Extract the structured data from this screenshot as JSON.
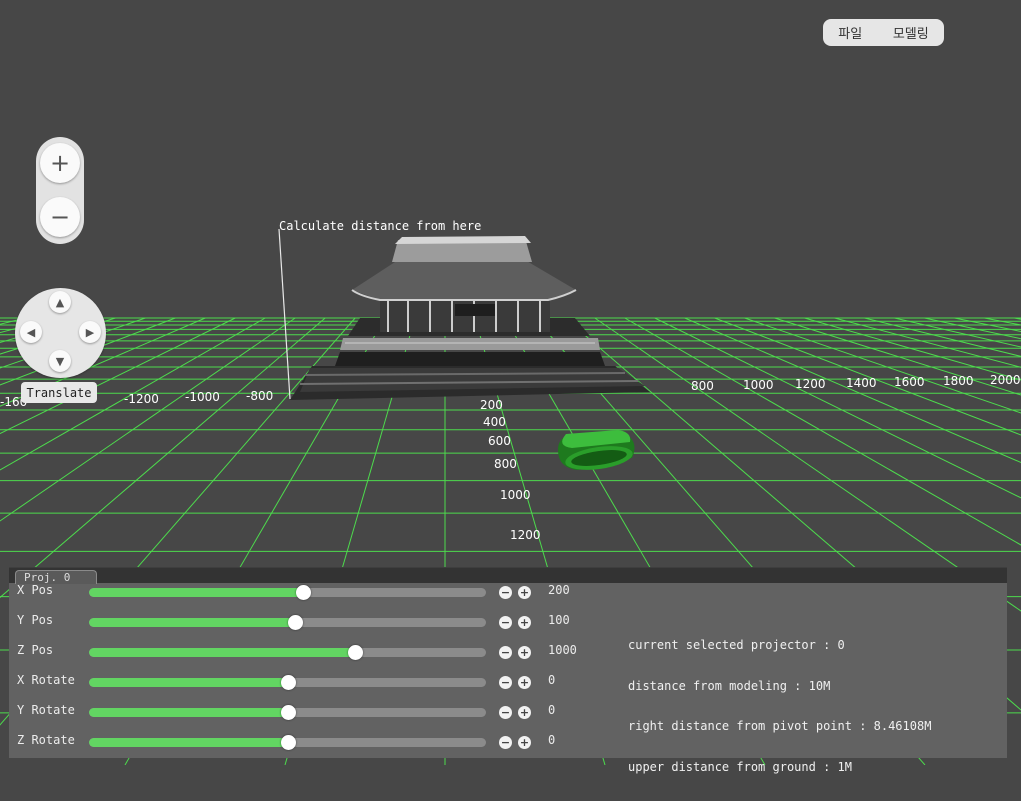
{
  "menu": {
    "file_label": "파일",
    "modeling_label": "모델링"
  },
  "zoom": {
    "in_symbol": "+",
    "out_symbol": "−"
  },
  "pad": {
    "up": "▲",
    "down": "▼",
    "left": "◀",
    "right": "▶",
    "mode_label": "Translate"
  },
  "scene": {
    "measure_label": "Calculate distance from here",
    "grid_color": "#4ddb4d",
    "x_ticks": [
      "-160",
      "-1200",
      "-1000",
      "-800",
      "800",
      "1000",
      "1200",
      "1400",
      "1600",
      "1800",
      "2000"
    ],
    "z_ticks": [
      "200",
      "400",
      "600",
      "800",
      "1000",
      "1200"
    ]
  },
  "panel": {
    "tab_label": "Proj. 0",
    "sliders": [
      {
        "label": "X Pos",
        "value": "200",
        "fraction": 0.54
      },
      {
        "label": "Y Pos",
        "value": "100",
        "fraction": 0.52
      },
      {
        "label": "Z Pos",
        "value": "1000",
        "fraction": 0.67
      },
      {
        "label": "X Rotate",
        "value": "0",
        "fraction": 0.5
      },
      {
        "label": "Y Rotate",
        "value": "0",
        "fraction": 0.5
      },
      {
        "label": "Z Rotate",
        "value": "0",
        "fraction": 0.5
      }
    ],
    "minus_symbol": "−",
    "plus_symbol": "+",
    "info": [
      "current selected projector : 0",
      "distance from modeling : 10M",
      "right distance from pivot point : 8.46108M",
      "upper distance from ground : 1M"
    ]
  }
}
